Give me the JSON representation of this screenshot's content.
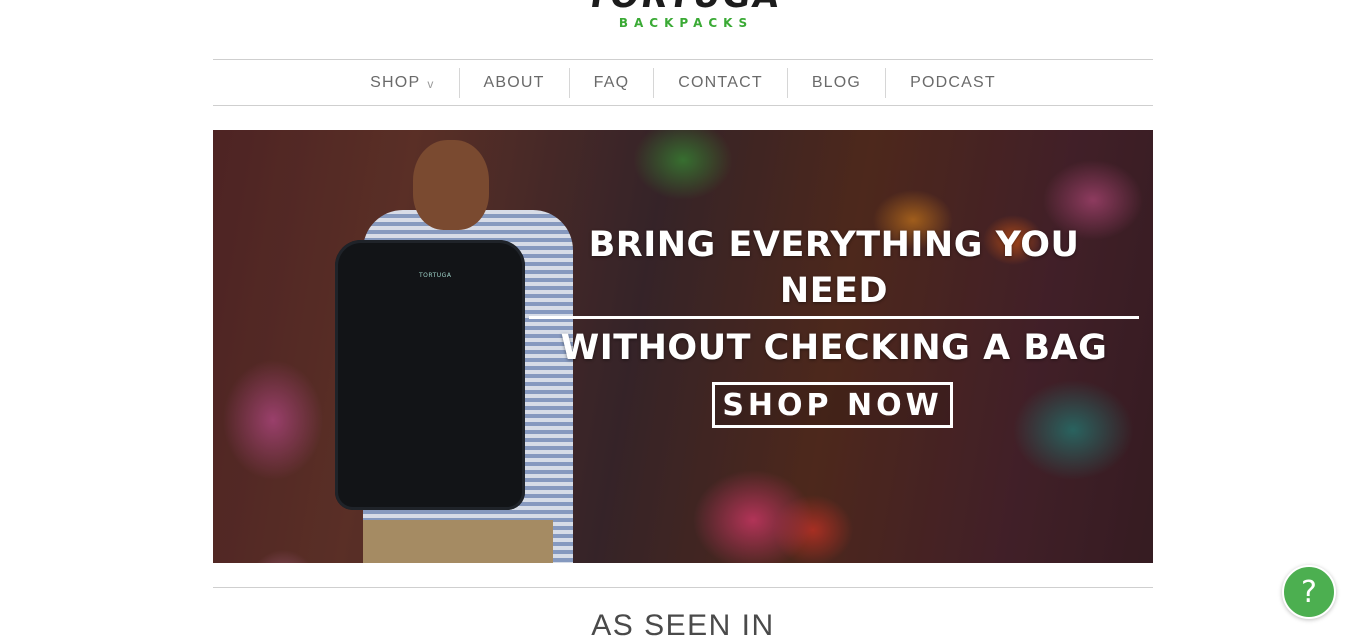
{
  "logo": {
    "main": "TORTUGA",
    "sub": "BACKPACKS"
  },
  "nav": {
    "items": [
      {
        "label": "SHOP",
        "has_dropdown": true,
        "caret": "v"
      },
      {
        "label": "ABOUT"
      },
      {
        "label": "FAQ"
      },
      {
        "label": "CONTACT"
      },
      {
        "label": "BLOG"
      },
      {
        "label": "PODCAST"
      }
    ]
  },
  "hero": {
    "line1": "BRING EVERYTHING YOU NEED",
    "line2": "WITHOUT CHECKING A BAG",
    "cta": "SHOP NOW",
    "backpack_brand": "TORTUGA"
  },
  "section": {
    "as_seen_in": "AS SEEN IN"
  },
  "help": {
    "icon": "question-mark-icon",
    "glyph": "?",
    "color": "#4caf50"
  },
  "colors": {
    "brand_green": "#3aaa35",
    "nav_text": "#6a6a6a"
  }
}
